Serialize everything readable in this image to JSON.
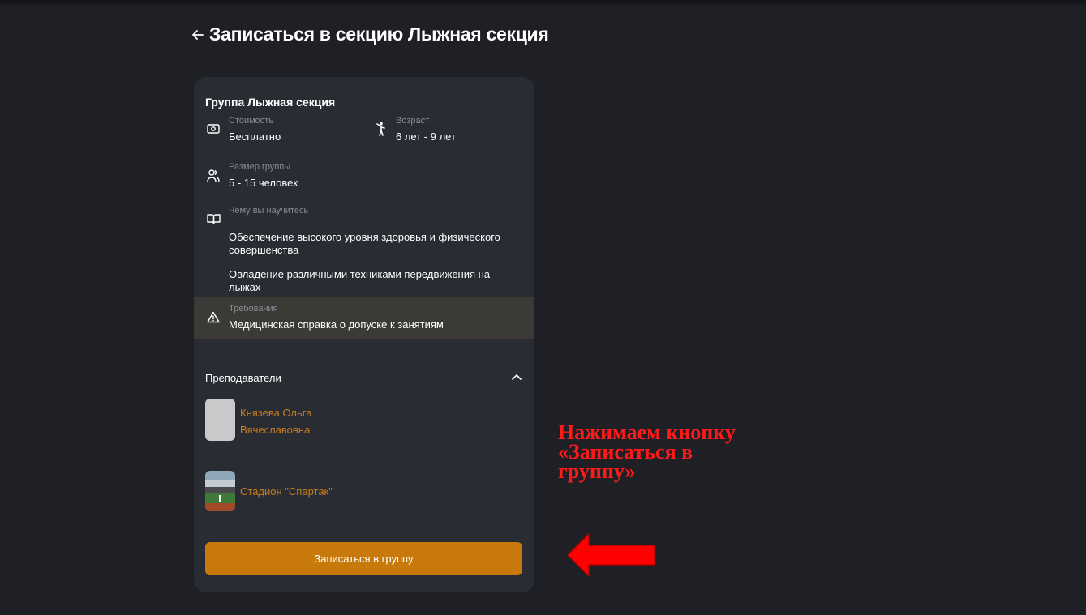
{
  "header": {
    "title": "Записаться в секцию Лыжная секция",
    "back_icon": "arrow-left-icon"
  },
  "group": {
    "title": "Группа Лыжная секция",
    "cost": {
      "label": "Стоимость",
      "value": "Бесплатно",
      "icon": "money-icon"
    },
    "age": {
      "label": "Возраст",
      "value": "6 лет - 9 лет",
      "icon": "person-icon"
    },
    "size": {
      "label": "Размер группы",
      "value": "5 - 15 человек",
      "icon": "users-icon"
    },
    "learn": {
      "label": "Чему вы научитесь",
      "icon": "book-icon",
      "items": [
        "Обеспечение высокого уровня здоровья и физического совершенства",
        "Овладение различными техниками передвижения на лыжах"
      ]
    },
    "requirements": {
      "label": "Требования",
      "value": "Медицинская справка о допуске к занятиям",
      "icon": "warning-icon"
    }
  },
  "teachers": {
    "title": "Преподаватели",
    "items": [
      {
        "name": "Князева Ольга Вячеславовна"
      }
    ]
  },
  "location": {
    "name": "Стадион \"Спартак\""
  },
  "enroll_button": {
    "label": "Записаться в группу"
  },
  "annotation": {
    "text": "Нажимаем кнопку «Записаться в группу»",
    "color": "#ff1a1a"
  },
  "colors": {
    "background": "#1f2026",
    "card": "#2a2c34",
    "accent": "#c8790b",
    "link": "#c87d1c"
  }
}
